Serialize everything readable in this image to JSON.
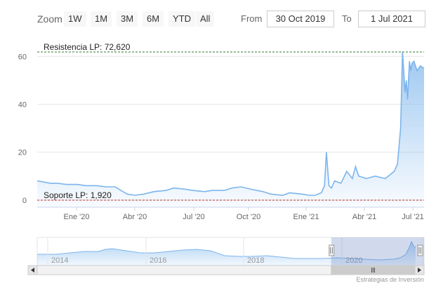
{
  "rangeSelector": {
    "zoom_label": "Zoom",
    "buttons": [
      "1W",
      "1M",
      "3M",
      "6M",
      "YTD",
      "All"
    ],
    "from_label": "From",
    "from_value": "30 Oct 2019",
    "to_label": "To",
    "to_value": "1 Jul 2021"
  },
  "credits": "Estrategias de Inversión",
  "colors": {
    "series": "#7cb5ec",
    "resistance_line": "#2e7d32",
    "support_line": "#c0392b",
    "navigator_mask": "#6685c2"
  },
  "chart_data": {
    "type": "area",
    "x_ticks": [
      "Ene '20",
      "Abr '20",
      "Jul '20",
      "Oct '20",
      "Ene '21",
      "Abr '21",
      "Jul '21"
    ],
    "yticks": [
      0,
      20,
      40,
      60
    ],
    "ylim": [
      -3,
      68
    ],
    "grid": true,
    "x_range": [
      "2019-10-30",
      "2021-07-01"
    ],
    "plot_lines": [
      {
        "label": "Resistencia LP: 72,620",
        "value": 72.62,
        "style": "dashed",
        "color": "#2e7d32"
      },
      {
        "label": "Soporte LP: 1,920",
        "value": 1.92,
        "style": "dashed",
        "color": "#c0392b"
      }
    ],
    "series": [
      {
        "x": [
          "2019-10-30",
          "2019-11-10",
          "2019-11-20",
          "2019-12-01",
          "2019-12-15",
          "2020-01-01",
          "2020-01-15",
          "2020-02-01",
          "2020-02-15",
          "2020-03-01",
          "2020-03-10",
          "2020-03-20",
          "2020-04-01",
          "2020-04-15",
          "2020-05-01",
          "2020-05-20",
          "2020-06-01",
          "2020-06-20",
          "2020-07-01",
          "2020-07-20",
          "2020-08-01",
          "2020-08-20",
          "2020-09-01",
          "2020-09-15",
          "2020-10-01",
          "2020-10-20",
          "2020-11-01",
          "2020-11-20",
          "2020-12-01",
          "2020-12-20",
          "2021-01-01",
          "2021-01-10",
          "2021-01-20",
          "2021-01-25",
          "2021-01-28",
          "2021-02-01",
          "2021-02-05",
          "2021-02-10",
          "2021-02-20",
          "2021-03-01",
          "2021-03-10",
          "2021-03-15",
          "2021-03-20",
          "2021-04-01",
          "2021-04-15",
          "2021-05-01",
          "2021-05-15",
          "2021-05-20",
          "2021-05-25",
          "2021-05-28",
          "2021-06-01",
          "2021-06-03",
          "2021-06-05",
          "2021-06-08",
          "2021-06-10",
          "2021-06-12",
          "2021-06-15",
          "2021-06-20",
          "2021-06-25",
          "2021-07-01"
        ],
        "y": [
          8,
          7.5,
          7,
          7,
          6.5,
          6.5,
          6,
          6,
          5.5,
          5.5,
          4,
          2.5,
          2,
          2.5,
          3.5,
          4,
          5,
          4.5,
          4,
          3.5,
          4,
          4,
          5,
          5.5,
          4.5,
          3.5,
          2.5,
          2,
          3,
          2.5,
          2,
          2,
          3,
          6,
          20,
          6,
          5,
          8,
          7,
          12,
          9,
          14,
          10,
          9,
          10,
          9,
          12,
          15,
          30,
          62,
          45,
          50,
          42,
          58,
          54,
          57,
          58,
          54,
          56,
          55
        ]
      }
    ]
  },
  "navigator": {
    "x_labels": [
      "2014",
      "2016",
      "2018",
      "2020"
    ],
    "selection": [
      0.76,
      1.0
    ]
  }
}
